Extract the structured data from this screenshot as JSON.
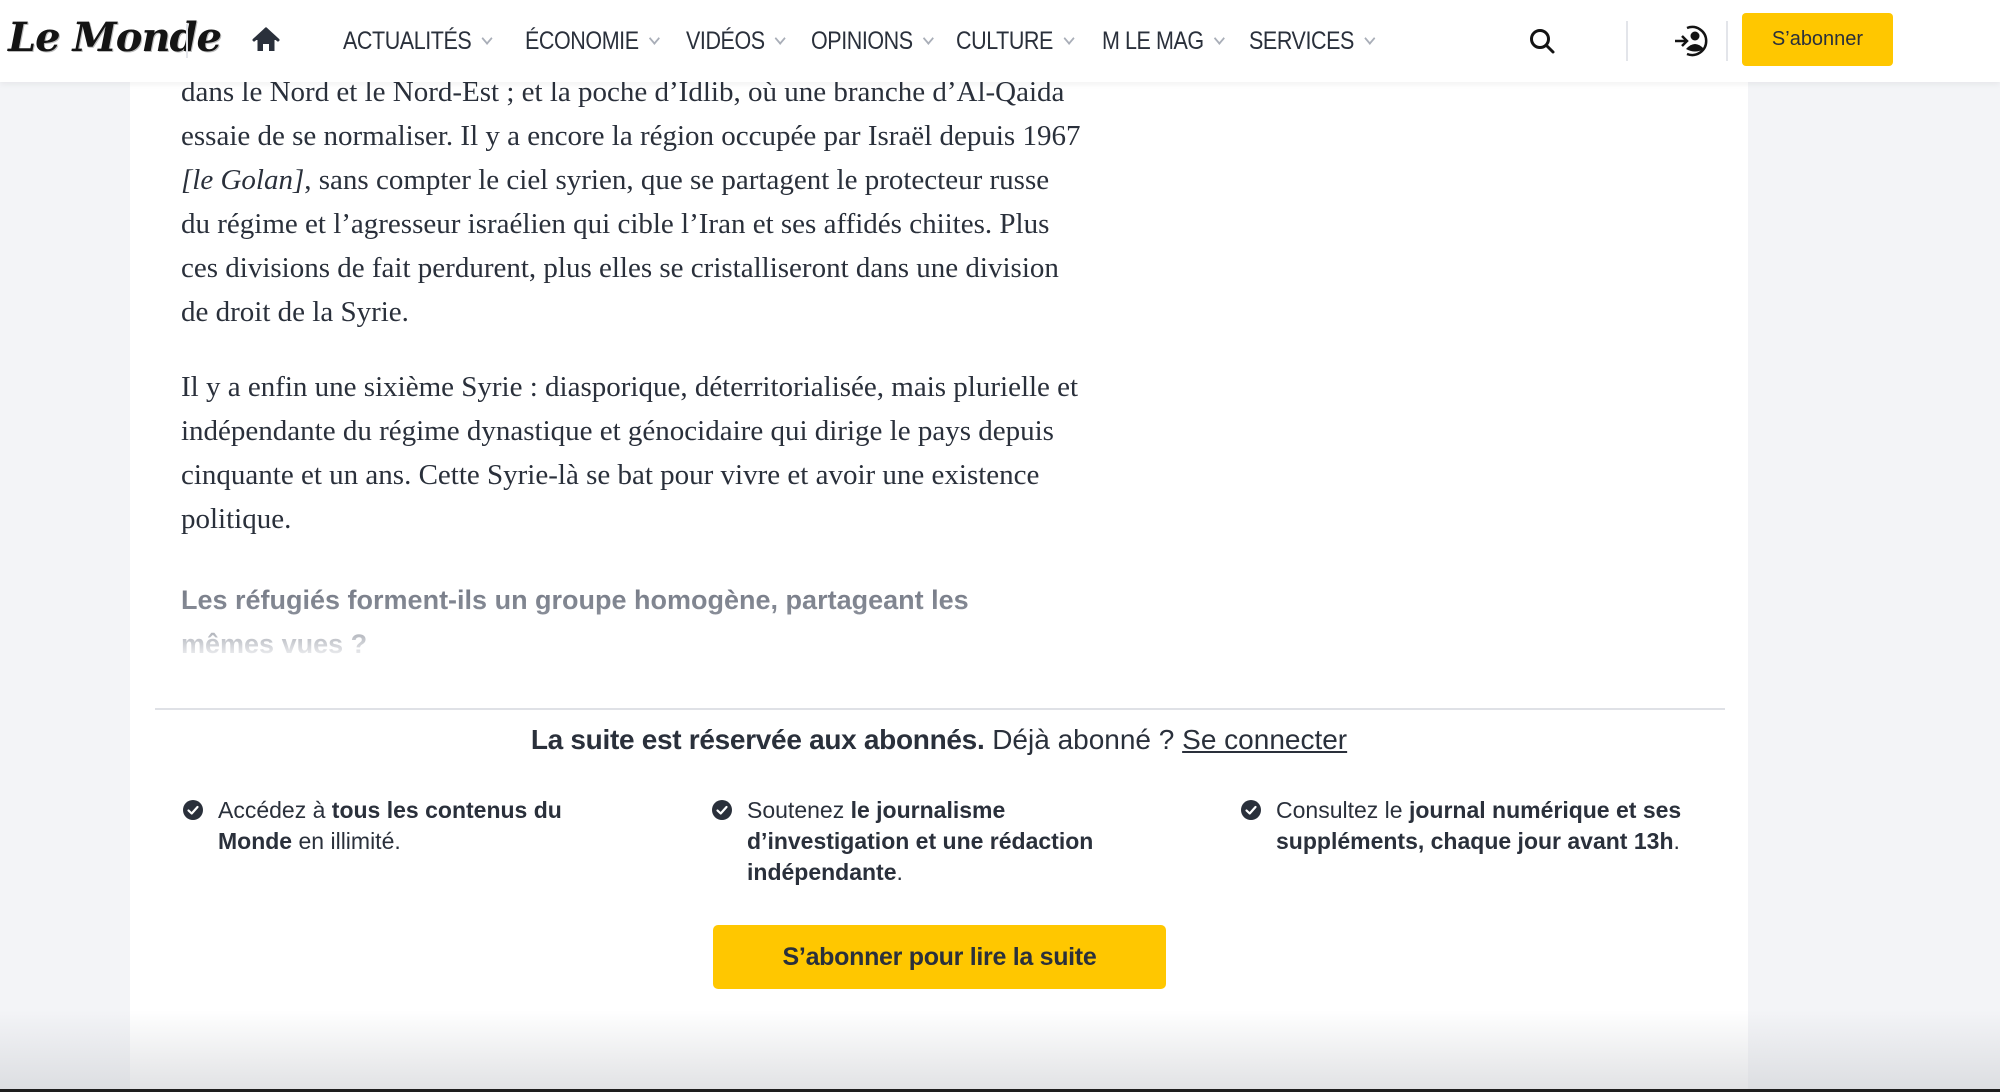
{
  "header": {
    "logo": "Le Monde",
    "nav": [
      {
        "label": "ACTUALITÉS",
        "has_dropdown": true
      },
      {
        "label": "ÉCONOMIE",
        "has_dropdown": true
      },
      {
        "label": "VIDÉOS",
        "has_dropdown": true
      },
      {
        "label": "OPINIONS",
        "has_dropdown": true
      },
      {
        "label": "CULTURE",
        "has_dropdown": true
      },
      {
        "label": "M LE MAG",
        "has_dropdown": true
      },
      {
        "label": "SERVICES",
        "has_dropdown": true
      }
    ],
    "icons": {
      "home": "home-icon",
      "search": "search-icon",
      "login": "login-icon"
    },
    "subscribe_label": "S’abonner"
  },
  "article": {
    "p1": {
      "before_em": "dans le Nord et le Nord-Est ; et la poche d’Idlib, où une branche d’Al-Qaida essaie de se normaliser. Il y a encore la région occupée par Israël depuis 1967 ",
      "em": "[le Golan]",
      "after_em": ", sans compter le ciel syrien, que se partagent le protecteur russe du régime et l’agresseur israélien qui cible l’Iran et ses affidés chiites. Plus ces divisions de fait perdurent, plus elles se cristalliseront dans une division de droit de la Syrie."
    },
    "p2": "Il y a enfin une sixième Syrie : diasporique, déterritorialisée, mais plurielle et indépendante du régime dynastique et génocidaire qui dirige le pays depuis cinquante et un ans. Cette Syrie-là se bat pour vivre et avoir une existence politique.",
    "subheading": "Les réfugiés forment-ils un groupe homogène, partageant les mêmes vues ?"
  },
  "paywall": {
    "title_strong": "La suite est réservée aux abonnés.",
    "title_light": "Déjà abonné ?",
    "login_link": "Se connecter",
    "benefits": [
      {
        "pre": "Accédez à ",
        "bold": "tous les contenus du Monde",
        "post": " en illimité."
      },
      {
        "pre": "Soutenez ",
        "bold": "le journalisme d’investigation et une rédaction indépendante",
        "post": "."
      },
      {
        "pre": "Consultez le ",
        "bold": "journal numérique et ses suppléments, chaque jour avant 13h",
        "post": "."
      }
    ],
    "cta_label": "S’abonner pour lire la suite"
  },
  "colors": {
    "accent_yellow": "#ffc700",
    "text_dark": "#2a303b",
    "page_bg": "#f3f4f7"
  }
}
